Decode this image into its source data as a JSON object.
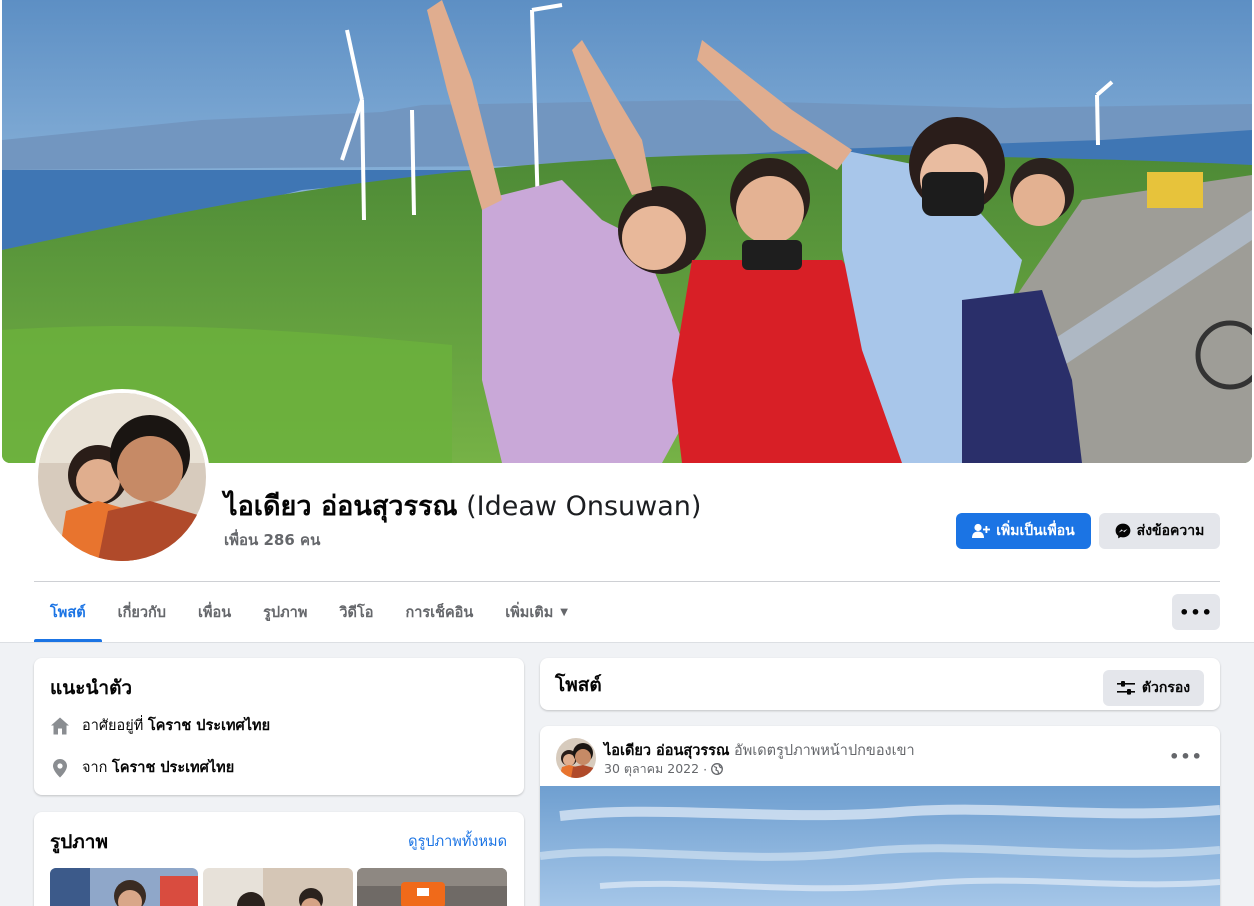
{
  "profile": {
    "name_th": "ไอเดียว อ่อนสุวรรณ",
    "name_en": "(Ideaw Onsuwan)",
    "friends": "เพื่อน 286 คน"
  },
  "actions": {
    "add_friend": "เพิ่มเป็นเพื่อน",
    "message": "ส่งข้อความ"
  },
  "tabs": [
    {
      "label": "โพสต์",
      "active": true
    },
    {
      "label": "เกี่ยวกับ"
    },
    {
      "label": "เพื่อน"
    },
    {
      "label": "รูปภาพ"
    },
    {
      "label": "วิดีโอ"
    },
    {
      "label": "การเช็คอิน"
    },
    {
      "label": "เพิ่มเติม"
    }
  ],
  "more_button": "•••",
  "intro": {
    "title": "แนะนำตัว",
    "lives_prefix": "อาศัยอยู่ที่",
    "lives_value": "โคราช ประเทศไทย",
    "from_prefix": "จาก",
    "from_value": "โคราช ประเทศไทย"
  },
  "photos": {
    "title": "รูปภาพ",
    "see_all": "ดูรูปภาพทั้งหมด"
  },
  "posts": {
    "title": "โพสต์",
    "filter_label": "ตัวกรอง"
  },
  "post": {
    "author": "ไอเดียว อ่อนสุวรรณ",
    "action": "อัพเดตรูปภาพหน้าปกของเขา",
    "date": "30 ตุลาคม 2022",
    "separator": "·",
    "more": "•••"
  },
  "colors": {
    "accent": "#1b74e4",
    "page_bg": "#f0f2f5",
    "secondary_text": "#65676b",
    "button_gray": "#e4e6eb"
  },
  "icons": {
    "add_friend": "person-plus-icon",
    "message": "messenger-icon",
    "home": "home-icon",
    "location": "map-pin-icon",
    "filter": "sliders-icon",
    "privacy": "globe-icon"
  }
}
